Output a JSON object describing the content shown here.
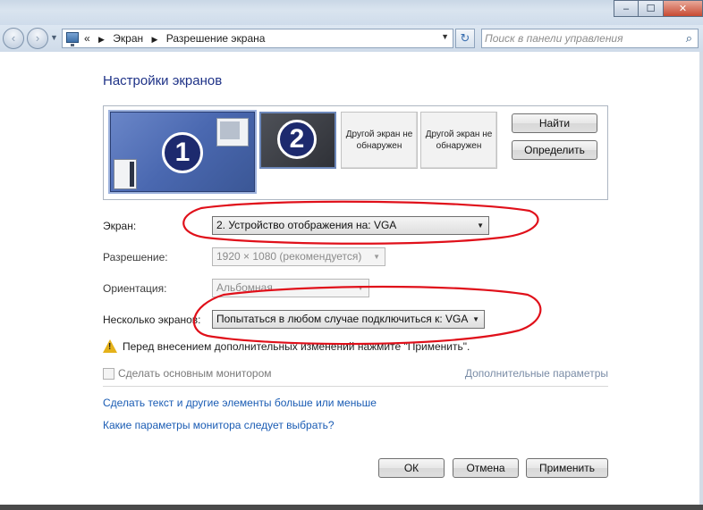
{
  "window_controls": {
    "minimize": "–",
    "maximize": "☐",
    "close": "✕"
  },
  "navigation": {
    "back": "‹",
    "forward": "›",
    "history_dropdown": "▼",
    "address": {
      "overflow": "«",
      "separator": "▶",
      "crumbs": [
        "Экран",
        "Разрешение экрана"
      ],
      "dropdown": "▼"
    },
    "refresh": "↻",
    "search": {
      "placeholder": "Поиск в панели управления",
      "icon": "⌕"
    }
  },
  "page": {
    "title": "Настройки экранов",
    "monitors": [
      {
        "number": "1",
        "state": "active"
      },
      {
        "number": "2",
        "state": "selected"
      },
      {
        "label": "Другой экран не обнаружен",
        "state": "ghost"
      },
      {
        "label": "Другой экран не обнаружен",
        "state": "ghost"
      }
    ],
    "find_button": "Найти",
    "identify_button": "Определить",
    "fields": {
      "screen": {
        "label": "Экран:",
        "value": "2. Устройство отображения на: VGA"
      },
      "resolution": {
        "label": "Разрешение:",
        "value": "1920 × 1080 (рекомендуется)",
        "disabled": true
      },
      "orientation": {
        "label": "Ориентация:",
        "value": "Альбомная",
        "disabled": true
      },
      "multiple": {
        "label": "Несколько экранов:",
        "value": "Попытаться в любом случае подключиться к: VGA"
      }
    },
    "dropdown_arrow": "▼",
    "warning": {
      "icon": "warning-triangle",
      "mark": "!",
      "text": "Перед внесением дополнительных изменений нажмите \"Применить\"."
    },
    "make_primary": {
      "label": "Сделать основным монитором",
      "checked": false,
      "disabled": true
    },
    "advanced_link": "Дополнительные параметры",
    "links": [
      "Сделать текст и другие элементы больше или меньше",
      "Какие параметры монитора следует выбрать?"
    ],
    "buttons": {
      "ok": "ОК",
      "cancel": "Отмена",
      "apply": "Применить"
    }
  },
  "colors": {
    "title": "#1e3287",
    "link": "#1a5cb4",
    "annotation": "#e0101a",
    "warning": "#e5b21a",
    "monitor_1": "#4a68b0",
    "monitor_2": "#2f3137"
  }
}
